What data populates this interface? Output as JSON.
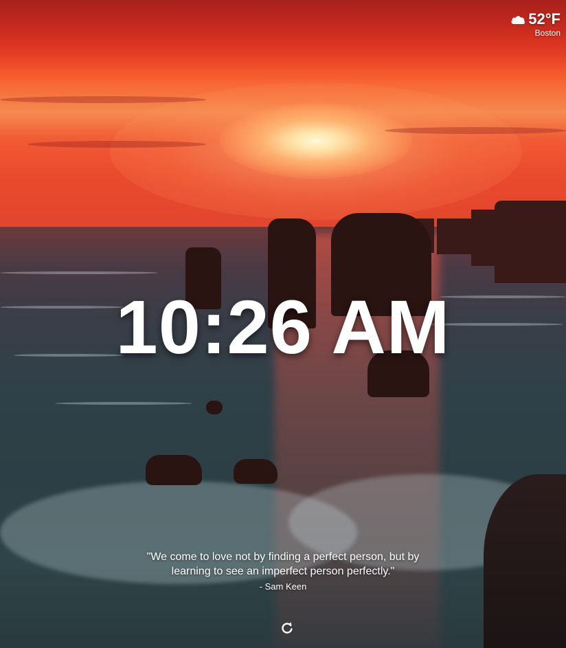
{
  "weather": {
    "icon": "cloud-icon",
    "temperature": "52°F",
    "city": "Boston"
  },
  "clock": {
    "time": "10:26 AM"
  },
  "quote": {
    "text": "\"We come to love not by finding a perfect person, but by learning to see an imperfect person perfectly.\"",
    "author": "- Sam Keen"
  },
  "controls": {
    "refresh_icon": "refresh-icon"
  },
  "colors": {
    "text": "#ffffff",
    "sky_accent": "#f2532b",
    "sea": "#2f4148"
  }
}
